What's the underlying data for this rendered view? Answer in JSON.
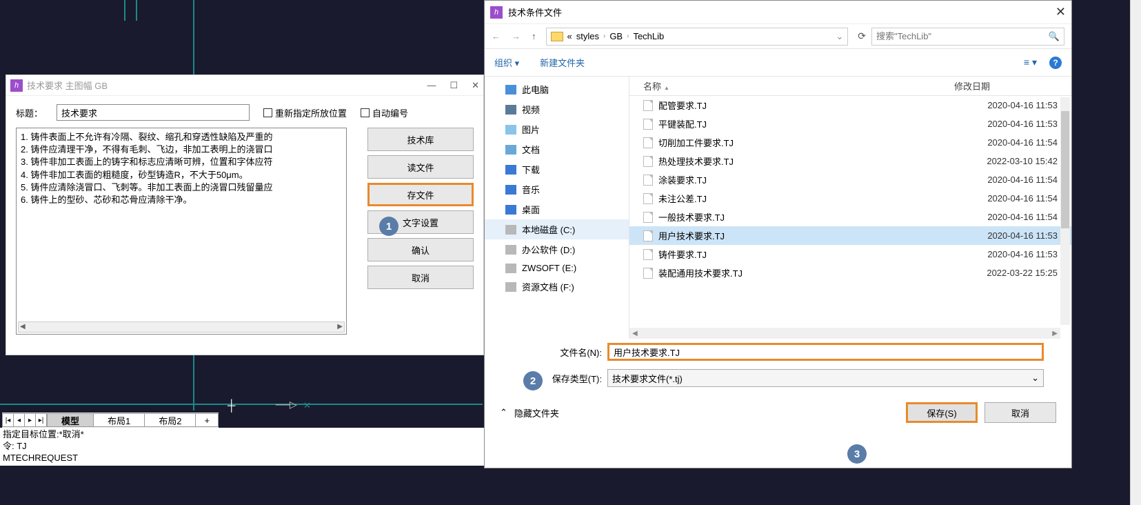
{
  "dlg1": {
    "title": "技术要求 主图幅 GB",
    "label_title": "标题：",
    "title_value": "技术要求",
    "chk_repos": "重新指定所放位置",
    "chk_autonum": "自动编号",
    "lines": [
      "1. 铸件表面上不允许有冷隔、裂纹、缩孔和穿透性缺陷及严重的",
      "2. 铸件应清理干净，不得有毛刺、飞边，非加工表明上的浇冒口",
      "3. 铸件非加工表面上的铸字和标志应清晰可辨，位置和字体应符",
      "4. 铸件非加工表面的粗糙度，砂型铸造R，不大于50μm。",
      "5. 铸件应清除浇冒口、飞刺等。非加工表面上的浇冒口残留量应",
      "6. 铸件上的型砂、芯砂和芯骨应清除干净。"
    ],
    "btn_lib": "技术库",
    "btn_read": "读文件",
    "btn_save": "存文件",
    "btn_font": "文字设置",
    "btn_ok": "确认",
    "btn_cancel": "取消"
  },
  "tabs": {
    "model": "模型",
    "layout1": "布局1",
    "layout2": "布局2",
    "plus": "+"
  },
  "cmd": {
    "l1": "指定目标位置:*取消*",
    "l2": "令: TJ",
    "l3": "MTECHREQUEST"
  },
  "dlg2": {
    "title": "技术条件文件",
    "bc_prefix": "«",
    "bc1": "styles",
    "bc2": "GB",
    "bc3": "TechLib",
    "search_placeholder": "搜索\"TechLib\"",
    "org": "组织 ▾",
    "newfolder": "新建文件夹",
    "col_name": "名称",
    "col_date": "修改日期",
    "tree": {
      "pc": "此电脑",
      "video": "视频",
      "pic": "图片",
      "doc": "文档",
      "download": "下载",
      "music": "音乐",
      "desktop": "桌面",
      "drive_c": "本地磁盘 (C:)",
      "drive_d": "办公软件 (D:)",
      "drive_e": "ZWSOFT (E:)",
      "drive_f": "资源文档 (F:)"
    },
    "files": [
      {
        "name": "配管要求.TJ",
        "date": "2020-04-16 11:53"
      },
      {
        "name": "平键装配.TJ",
        "date": "2020-04-16 11:53"
      },
      {
        "name": "切削加工件要求.TJ",
        "date": "2020-04-16 11:54"
      },
      {
        "name": "热处理技术要求.TJ",
        "date": "2022-03-10 15:42"
      },
      {
        "name": "涂装要求.TJ",
        "date": "2020-04-16 11:54"
      },
      {
        "name": "未注公差.TJ",
        "date": "2020-04-16 11:54"
      },
      {
        "name": "一般技术要求.TJ",
        "date": "2020-04-16 11:54"
      },
      {
        "name": "用户技术要求.TJ",
        "date": "2020-04-16 11:53",
        "sel": true
      },
      {
        "name": "铸件要求.TJ",
        "date": "2020-04-16 11:53"
      },
      {
        "name": "装配通用技术要求.TJ",
        "date": "2022-03-22 15:25"
      }
    ],
    "label_filename": "文件名(N):",
    "filename_value": "用户技术要求.TJ",
    "label_type": "保存类型(T):",
    "type_value": "技术要求文件(*.tj)",
    "hide_folders": "隐藏文件夹",
    "btn_save": "保存(S)",
    "btn_cancel": "取消"
  }
}
